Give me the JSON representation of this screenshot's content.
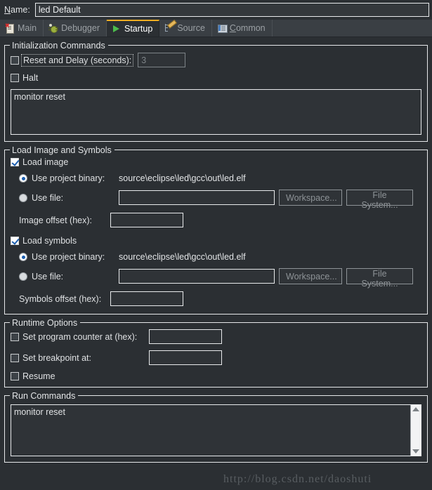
{
  "window": {
    "name_label_prefix": "N",
    "name_label_rest": "ame:",
    "name_value": "led Default"
  },
  "tabs": [
    {
      "label": "Main",
      "icon": "document-error-icon",
      "active": false,
      "mnemonic": ""
    },
    {
      "label": "Debugger",
      "icon": "bug-icon",
      "active": false,
      "mnemonic": ""
    },
    {
      "label": "Startup",
      "icon": "play-icon",
      "active": true,
      "mnemonic": ""
    },
    {
      "label": "Source",
      "icon": "source-tree-icon",
      "active": false,
      "mnemonic": ""
    },
    {
      "label": "Common",
      "icon": "window-list-icon",
      "active": false,
      "mnemonic": "C"
    }
  ],
  "initialization": {
    "legend": "Initialization Commands",
    "reset_delay_label": "Reset and Delay (seconds):",
    "reset_delay_checked": false,
    "reset_delay_value": "3",
    "reset_delay_disabled": true,
    "halt_label": "Halt",
    "halt_checked": false,
    "commands_text": "monitor reset"
  },
  "load": {
    "legend": "Load Image and Symbols",
    "image": {
      "checkbox_label": "Load image",
      "checked": true,
      "project_binary_label": "Use project binary:",
      "project_binary_selected": true,
      "project_binary_path": "source\\eclipse\\led\\gcc\\out\\led.elf",
      "use_file_label": "Use file:",
      "use_file_selected": false,
      "use_file_value": "",
      "workspace_button": "Workspace...",
      "filesystem_button": "File System...",
      "offset_label": "Image offset (hex):",
      "offset_value": ""
    },
    "symbols": {
      "checkbox_label": "Load symbols",
      "checked": true,
      "project_binary_label": "Use project binary:",
      "project_binary_selected": true,
      "project_binary_path": "source\\eclipse\\led\\gcc\\out\\led.elf",
      "use_file_label": "Use file:",
      "use_file_selected": false,
      "use_file_value": "",
      "workspace_button": "Workspace...",
      "filesystem_button": "File System...",
      "offset_label": "Symbols offset (hex):",
      "offset_value": ""
    }
  },
  "runtime": {
    "legend": "Runtime Options",
    "pc_label": "Set program counter at (hex):",
    "pc_checked": false,
    "pc_value": "",
    "bp_label": "Set breakpoint at:",
    "bp_checked": false,
    "bp_value": "",
    "resume_label": "Resume",
    "resume_checked": false
  },
  "run_commands": {
    "legend": "Run Commands",
    "text": "monitor reset"
  },
  "watermark": "http://blog.csdn.net/daoshuti",
  "colors": {
    "background": "#2b2f33",
    "tabbar": "#3a3f44",
    "active_tab_accent": "#f0ad22",
    "accent_blue": "#1c5fb0",
    "border": "#e6e8ea",
    "text": "#dfe1e3",
    "disabled_text": "#8e9397"
  }
}
